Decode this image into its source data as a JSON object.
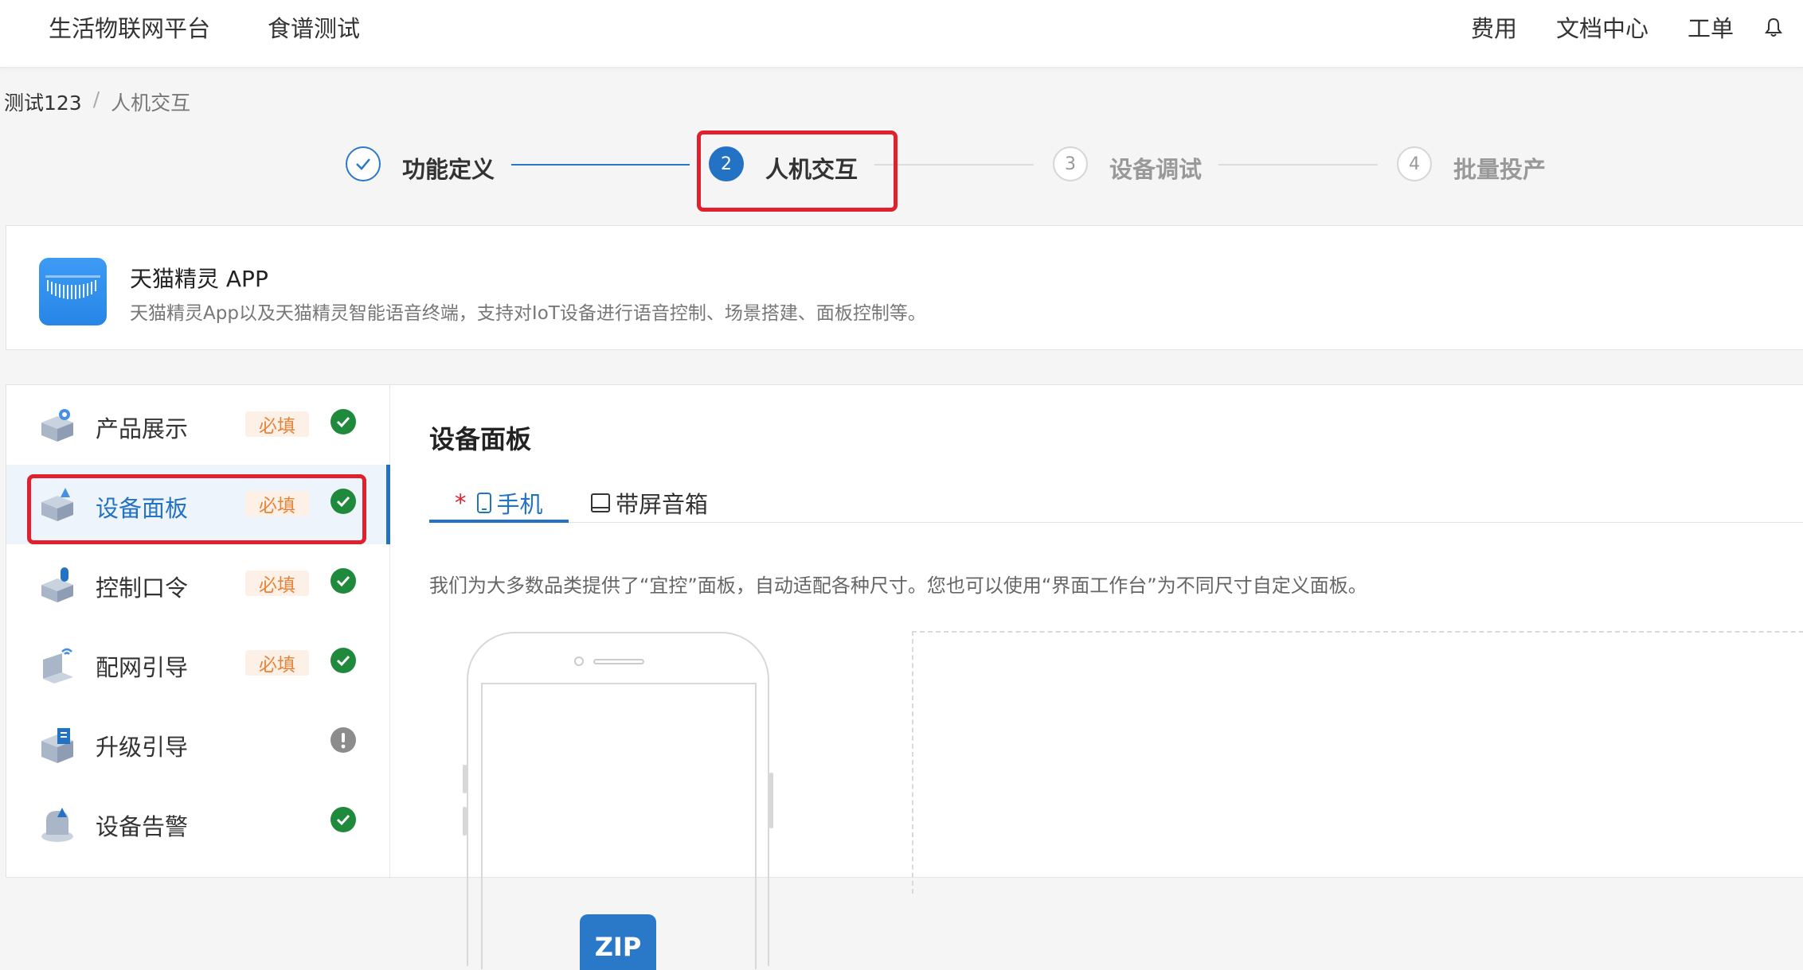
{
  "topnav": {
    "left": [
      "生活物联网平台",
      "食谱测试"
    ],
    "right": [
      "费用",
      "文档中心",
      "工单"
    ]
  },
  "breadcrumb": {
    "root": "测试123",
    "separator": "/",
    "current": "人机交互"
  },
  "steps": [
    {
      "number": "",
      "label": "功能定义",
      "state": "done"
    },
    {
      "number": "2",
      "label": "人机交互",
      "state": "active"
    },
    {
      "number": "3",
      "label": "设备调试",
      "state": "todo"
    },
    {
      "number": "4",
      "label": "批量投产",
      "state": "todo"
    }
  ],
  "app": {
    "name": "天猫精灵 APP",
    "description": "天猫精灵App以及天猫精灵智能语音终端，支持对IoT设备进行语音控制、场景搭建、面板控制等。"
  },
  "sidebar": {
    "items": [
      {
        "label": "产品展示",
        "badge": "必填",
        "status": "complete"
      },
      {
        "label": "设备面板",
        "badge": "必填",
        "status": "complete"
      },
      {
        "label": "控制口令",
        "badge": "必填",
        "status": "complete"
      },
      {
        "label": "配网引导",
        "badge": "必填",
        "status": "complete"
      },
      {
        "label": "升级引导",
        "badge": "",
        "status": "warning"
      },
      {
        "label": "设备告警",
        "badge": "",
        "status": "complete"
      }
    ]
  },
  "content": {
    "title": "设备面板",
    "tabs": [
      {
        "label": "手机",
        "required_mark": "*"
      },
      {
        "label": "带屏音箱"
      }
    ],
    "description": "我们为大多数品类提供了“宜控”面板，自动适配各种尺寸。您也可以使用“界面工作台”为不同尺寸自定义面板。",
    "zip_label": "ZIP"
  },
  "colors": {
    "primary": "#2372c4",
    "success": "#1f8a3c",
    "warning": "#8c8c8c",
    "highlight": "#e0202d",
    "badge_text": "#e8833a",
    "badge_bg": "#fdf0e6"
  }
}
